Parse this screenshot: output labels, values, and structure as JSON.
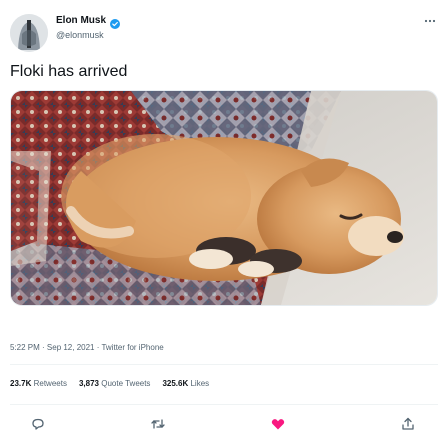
{
  "author": {
    "name": "Elon Musk",
    "handle": "@elonmusk"
  },
  "tweet": {
    "text": "Floki has arrived",
    "timestamp": "5:22 PM · Sep 12, 2021 · Twitter for iPhone"
  },
  "stats": {
    "retweets_count": "23.7K",
    "retweets_label": "Retweets",
    "quotes_count": "3,873",
    "quotes_label": "Quote Tweets",
    "likes_count": "325.6K",
    "likes_label": "Likes"
  },
  "icons": {
    "more": "more-icon",
    "reply": "reply-icon",
    "retweet": "retweet-icon",
    "like": "like-icon",
    "share": "share-icon",
    "verified": "verified-badge-icon"
  },
  "colors": {
    "verified": "#1d9bf0",
    "like": "#f91880",
    "secondary_text": "#536471"
  }
}
